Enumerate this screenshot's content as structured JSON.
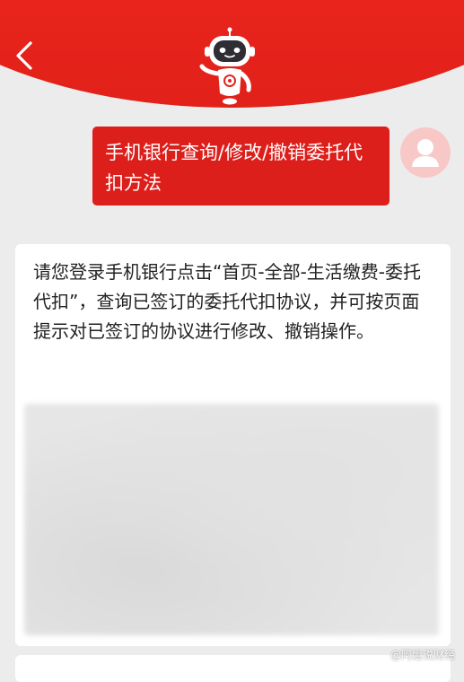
{
  "header": {
    "back_icon": "chevron-left-icon",
    "robot_icon": "assistant-robot-icon"
  },
  "chat": {
    "user_message": "手机银行查询/修改/撤销委托代扣方法",
    "user_avatar_icon": "user-avatar-icon",
    "answer_text": "请您登录手机银行点击“首页-全部-生活缴费-委托代扣”，查询已签订的委托代扣协议，并可按页面提示对已签订的协议进行修改、撤销操作。",
    "answer_image": "blurred-screenshot"
  },
  "watermark": {
    "text": "@阿姐说财经"
  },
  "colors": {
    "header_red": "#e8241c",
    "bubble_red": "#dd1f1c",
    "background": "#ececec",
    "avatar_pink": "#f8c8c7"
  }
}
